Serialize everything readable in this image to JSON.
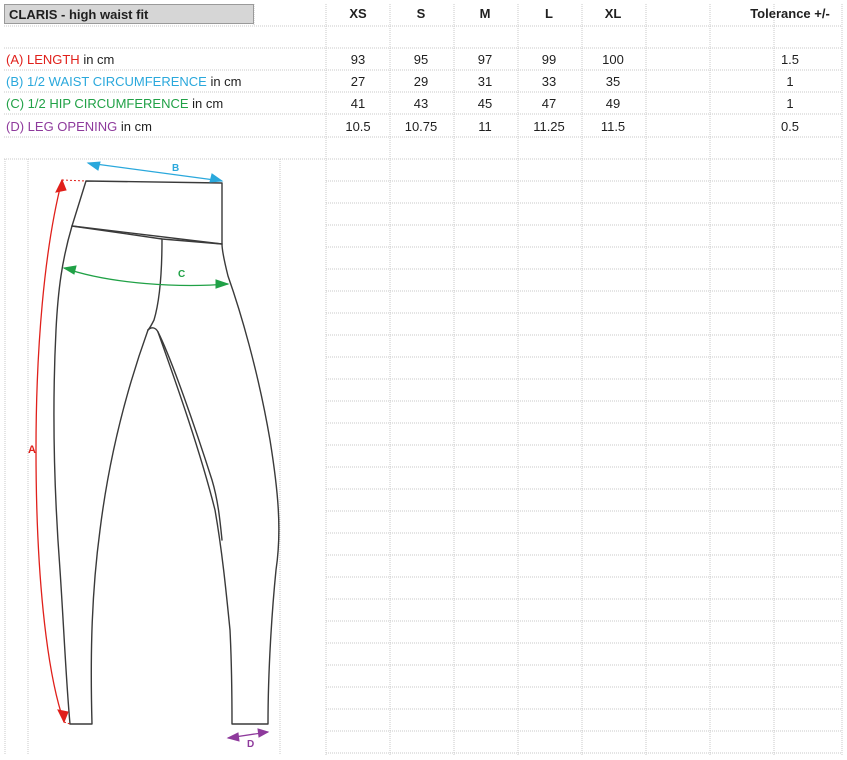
{
  "sheet": {
    "title": "CLARIS - high waist fit",
    "sizes": [
      "XS",
      "S",
      "M",
      "L",
      "XL"
    ],
    "tolerance_header": "Tolerance +/-"
  },
  "rows": [
    {
      "code": "(A)",
      "name": "LENGTH",
      "unit": " in cm",
      "color": "#e0201b",
      "values": [
        "93",
        "95",
        "97",
        "99",
        "100"
      ],
      "tolerance": "1.5"
    },
    {
      "code": "(B)",
      "name": "1/2 WAIST CIRCUMFERENCE",
      "unit": " in cm",
      "color": "#2aa8dc",
      "values": [
        "27",
        "29",
        "31",
        "33",
        "35"
      ],
      "tolerance": "1"
    },
    {
      "code": "(C)",
      "name": "1/2 HIP CIRCUMFERENCE",
      "unit": " in cm",
      "color": "#20a146",
      "values": [
        "41",
        "43",
        "45",
        "47",
        "49"
      ],
      "tolerance": "1"
    },
    {
      "code": "(D)",
      "name": "LEG OPENING",
      "unit": " in cm",
      "color": "#8e3a9c",
      "values": [
        "10.5",
        "10.75",
        "11",
        "11.25",
        "11.5"
      ],
      "tolerance": "0.5"
    }
  ],
  "diagram": {
    "label_a": "A",
    "label_b": "B",
    "label_c": "C",
    "label_d": "D",
    "colors": {
      "a": "#e0201b",
      "b": "#2aa8dc",
      "c": "#20a146",
      "d": "#8e3a9c",
      "outline": "#3a3a3a"
    }
  }
}
